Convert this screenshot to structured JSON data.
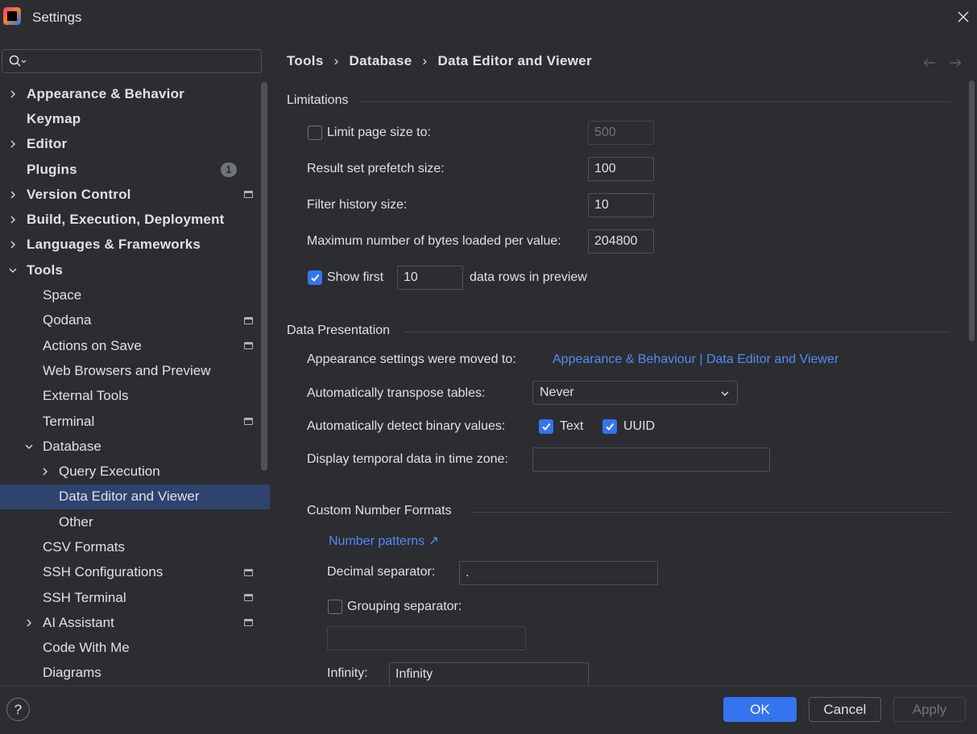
{
  "window": {
    "title": "Settings"
  },
  "search": {
    "placeholder": "",
    "value": ""
  },
  "tree": [
    {
      "label": "Appearance & Behavior",
      "level": 0,
      "top": true,
      "chevron": "right"
    },
    {
      "label": "Keymap",
      "level": 0,
      "top": true
    },
    {
      "label": "Editor",
      "level": 0,
      "top": true,
      "chevron": "right"
    },
    {
      "label": "Plugins",
      "level": 0,
      "top": true,
      "badge": "1"
    },
    {
      "label": "Version Control",
      "level": 0,
      "top": true,
      "chevron": "right",
      "project": true
    },
    {
      "label": "Build, Execution, Deployment",
      "level": 0,
      "top": true,
      "chevron": "right"
    },
    {
      "label": "Languages & Frameworks",
      "level": 0,
      "top": true,
      "chevron": "right"
    },
    {
      "label": "Tools",
      "level": 0,
      "top": true,
      "chevron": "down"
    },
    {
      "label": "Space",
      "level": 1
    },
    {
      "label": "Qodana",
      "level": 1,
      "project": true
    },
    {
      "label": "Actions on Save",
      "level": 1,
      "project": true
    },
    {
      "label": "Web Browsers and Preview",
      "level": 1
    },
    {
      "label": "External Tools",
      "level": 1
    },
    {
      "label": "Terminal",
      "level": 1,
      "project": true
    },
    {
      "label": "Database",
      "level": 1,
      "chevron": "down"
    },
    {
      "label": "Query Execution",
      "level": 2,
      "chevron": "right"
    },
    {
      "label": "Data Editor and Viewer",
      "level": 2,
      "selected": true
    },
    {
      "label": "Other",
      "level": 2
    },
    {
      "label": "CSV Formats",
      "level": 1
    },
    {
      "label": "SSH Configurations",
      "level": 1,
      "project": true
    },
    {
      "label": "SSH Terminal",
      "level": 1,
      "project": true
    },
    {
      "label": "AI Assistant",
      "level": 1,
      "chevron": "right",
      "project": true
    },
    {
      "label": "Code With Me",
      "level": 1
    },
    {
      "label": "Diagrams",
      "level": 1
    }
  ],
  "breadcrumb": {
    "items": [
      "Tools",
      "Database",
      "Data Editor and Viewer"
    ],
    "separator": "›"
  },
  "limitations": {
    "title": "Limitations",
    "limit_page_size": {
      "label": "Limit page size to:",
      "checked": false,
      "value": "500"
    },
    "prefetch": {
      "label": "Result set prefetch size:",
      "value": "100"
    },
    "filter_history": {
      "label": "Filter history size:",
      "value": "10"
    },
    "max_bytes": {
      "label": "Maximum number of bytes loaded per value:",
      "value": "204800"
    },
    "show_first": {
      "label": "Show first",
      "checked": true,
      "value": "10",
      "suffix": "data rows in preview"
    }
  },
  "data_presentation": {
    "title": "Data Presentation",
    "appearance_moved": {
      "label": "Appearance settings were moved to:",
      "link": "Appearance & Behaviour | Data Editor and Viewer"
    },
    "transpose": {
      "label": "Automatically transpose tables:",
      "value": "Never"
    },
    "binary": {
      "label": "Automatically detect binary values:",
      "text_label": "Text",
      "text_checked": true,
      "uuid_label": "UUID",
      "uuid_checked": true
    },
    "timezone": {
      "label": "Display temporal data in time zone:",
      "value": ""
    }
  },
  "number_formats": {
    "title": "Custom Number Formats",
    "patterns_link": "Number patterns ↗",
    "decimal": {
      "label": "Decimal separator:",
      "value": "."
    },
    "grouping": {
      "label": "Grouping separator:",
      "checked": false,
      "value": ""
    },
    "infinity": {
      "label": "Infinity:",
      "value": "Infinity"
    }
  },
  "footer": {
    "help": "?",
    "ok": "OK",
    "cancel": "Cancel",
    "apply": "Apply"
  },
  "colors": {
    "background": "#2b2d30",
    "accent": "#3574f0",
    "link": "#548af7",
    "selection": "#2e436e",
    "text": "#dfe1e5"
  }
}
